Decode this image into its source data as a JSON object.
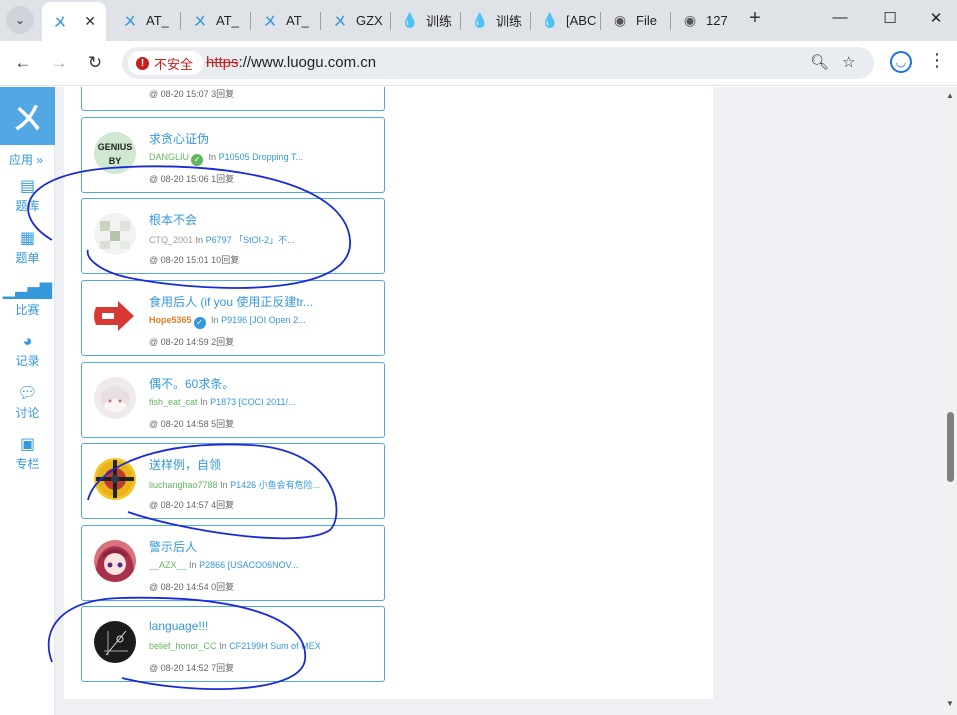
{
  "browser": {
    "tabs": [
      {
        "title": "",
        "icon": "luogu-icon",
        "active": true
      },
      {
        "title": "AT_",
        "icon": "luogu-icon"
      },
      {
        "title": "AT_",
        "icon": "luogu-icon"
      },
      {
        "title": "AT_",
        "icon": "luogu-icon"
      },
      {
        "title": "GZX",
        "icon": "luogu-icon"
      },
      {
        "title": "训练",
        "icon": "drop-icon"
      },
      {
        "title": "训练",
        "icon": "drop-icon"
      },
      {
        "title": "[ABC",
        "icon": "drop-icon"
      },
      {
        "title": "File",
        "icon": "globe-icon"
      },
      {
        "title": "127",
        "icon": "globe-icon"
      }
    ],
    "address": {
      "security_label": "不安全",
      "scheme": "https",
      "rest": "://www.luogu.com.cn"
    }
  },
  "sidebar": {
    "apps_label": "应用 »",
    "items": [
      {
        "label": "题库",
        "icon": "book-icon"
      },
      {
        "label": "题单",
        "icon": "list-icon"
      },
      {
        "label": "比赛",
        "icon": "bar-chart-icon"
      },
      {
        "label": "记录",
        "icon": "pie-chart-icon"
      },
      {
        "label": "讨论",
        "icon": "chat-icon"
      },
      {
        "label": "专栏",
        "icon": "newspaper-icon"
      }
    ]
  },
  "posts": {
    "partial_time": "@ 08-20 15:07 3回复",
    "items": [
      {
        "title": "求贪心证伪",
        "user": "DANGLIU",
        "user_color": "#5eb95e",
        "verified": true,
        "verified_color": "#5eb95e",
        "problem": "P10505 Dropping T...",
        "time": "@ 08-20 15:06 1回复",
        "avatar_text": "GENIUS BY"
      },
      {
        "title": "根本不会",
        "user": "CTQ_2001",
        "user_color": "#9d9d9d",
        "verified": false,
        "problem": "P6797 「StOI-2」不...",
        "time": "@ 08-20 15:01 10回复",
        "avatar_text": ""
      },
      {
        "title": "食用后人 (if you 使用正反建tr...",
        "user": "Hope5365",
        "user_color": "#e67e22",
        "verified": true,
        "verified_color": "#3498db",
        "problem": "P9196 [JOI Open 2...",
        "time": "@ 08-20 14:59 2回复",
        "avatar_text": ""
      },
      {
        "title": "偶不。60求条。",
        "user": "fish_eat_cat",
        "user_color": "#5eb95e",
        "verified": false,
        "problem": "P1873 [COCI 2011/...",
        "time": "@ 08-20 14:58 5回复",
        "avatar_text": ""
      },
      {
        "title": "送样例，自领",
        "user": "liuchanghao7788",
        "user_color": "#5eb95e",
        "verified": false,
        "problem": "P1426 小鱼会有危险...",
        "time": "@ 08-20 14:57 4回复",
        "avatar_text": ""
      },
      {
        "title": "警示后人",
        "user": "__AZX__",
        "user_color": "#5eb95e",
        "verified": false,
        "problem": "P2866 [USACO06NOV...",
        "time": "@ 08-20 14:54 0回复",
        "avatar_text": ""
      },
      {
        "title": "language!!!",
        "user": "belief_honor_CC",
        "user_color": "#5eb95e",
        "verified": false,
        "problem": "CF2199H Sum of MEX",
        "time": "@ 08-20 14:52 7回复",
        "avatar_text": ""
      }
    ]
  },
  "labels": {
    "in_word": "In"
  }
}
